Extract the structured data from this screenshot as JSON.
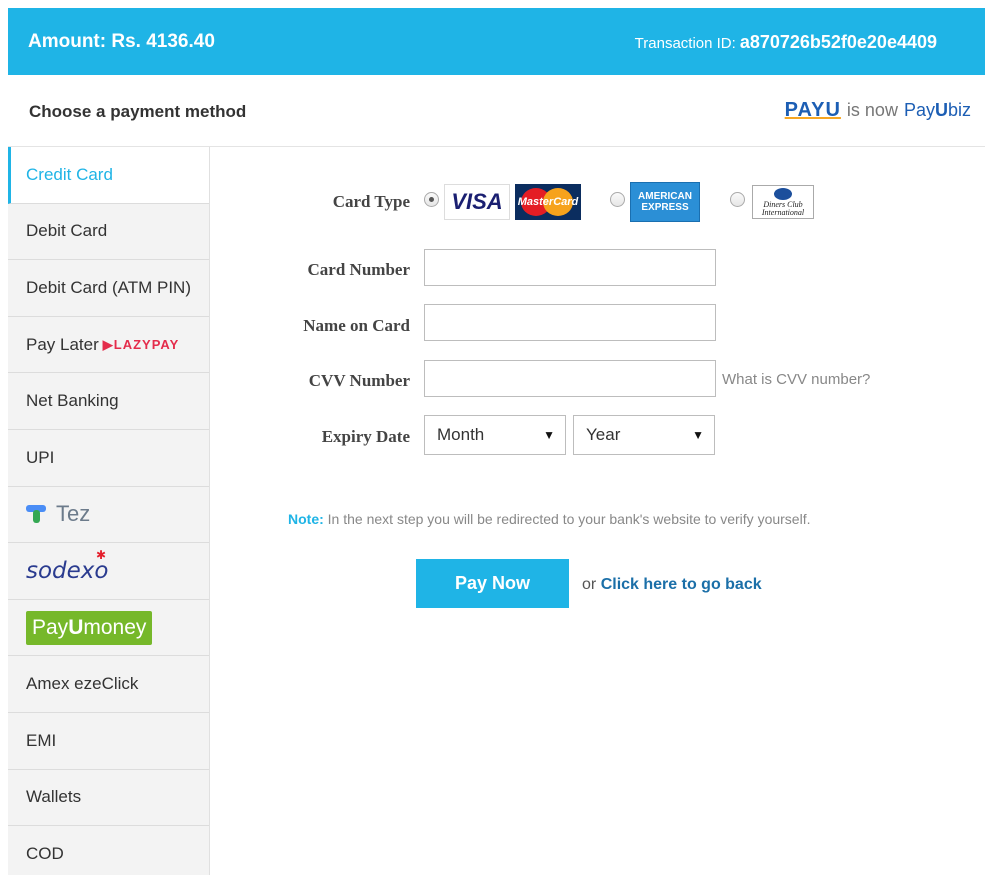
{
  "header": {
    "amount": "Amount: Rs. 4136.40",
    "txn_label": "Transaction ID:",
    "txn_id": "a870726b52f0e20e4409"
  },
  "subheader": {
    "choose": "Choose a payment method",
    "payu_old": "PAYU",
    "is_now": "is now",
    "payu_biz_pay": "Pay",
    "payu_biz_u": "U",
    "payu_biz_biz": "biz"
  },
  "sidebar": {
    "credit_card": "Credit Card",
    "debit_card": "Debit Card",
    "debit_atm": "Debit Card (ATM PIN)",
    "pay_later": "Pay Later",
    "lazypay": "LAZYPAY",
    "net_banking": "Net Banking",
    "upi": "UPI",
    "tez": "Tez",
    "sodexo": "sodexo",
    "payumoney_pay": "Pay",
    "payumoney_u": "U",
    "payumoney_money": "money",
    "amex": "Amex ezeClick",
    "emi": "EMI",
    "wallets": "Wallets",
    "cod": "COD"
  },
  "form": {
    "card_type_label": "Card Type",
    "visa": "VISA",
    "mastercard": "MasterCard",
    "amex_line1": "AMERICAN",
    "amex_line2": "EXPRESS",
    "diners_line1": "Diners Club",
    "diners_line2": "International",
    "card_number_label": "Card Number",
    "name_label": "Name on Card",
    "cvv_label": "CVV Number",
    "cvv_help": "What is CVV number?",
    "expiry_label": "Expiry Date",
    "month": "Month",
    "year": "Year",
    "note_label": "Note:",
    "note_text": " In the next step you will be redirected to your bank's website to verify yourself.",
    "pay_now": "Pay Now",
    "or": "or",
    "go_back": "Click here to go back"
  }
}
